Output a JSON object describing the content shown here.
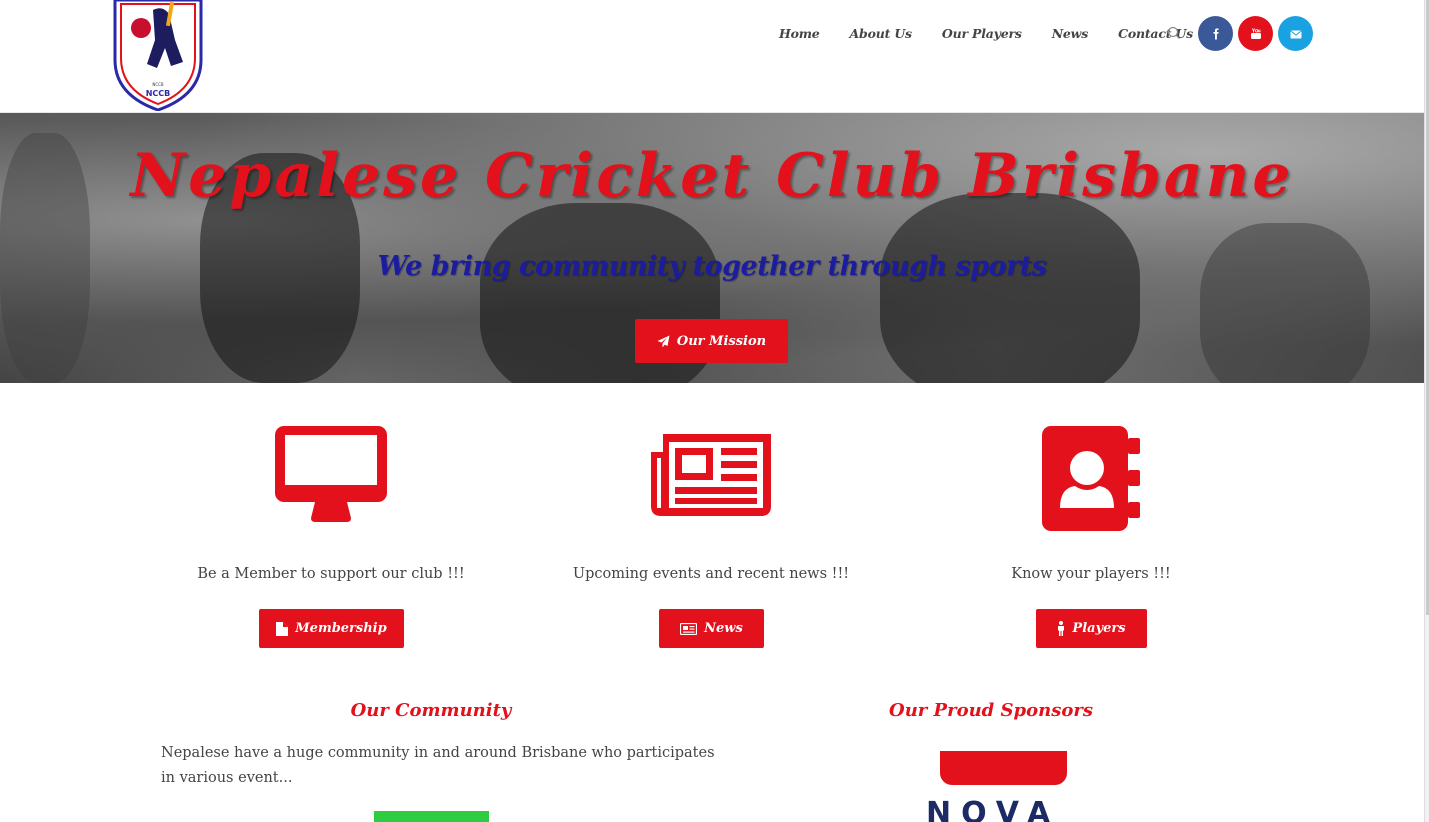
{
  "header": {
    "logo_alt": "NCCB",
    "logo_text": "NCCB",
    "nav": [
      "Home",
      "About Us",
      "Our Players",
      "News",
      "Contact Us"
    ],
    "search_icon": "search-icon",
    "social": [
      "facebook-icon",
      "youtube-icon",
      "email-icon"
    ]
  },
  "hero": {
    "title": "Nepalese Cricket Club Brisbane",
    "subtitle": "We bring community together through sports",
    "button_label": "Our Mission",
    "button_icon": "paper-plane-icon"
  },
  "features": [
    {
      "icon": "desktop-icon",
      "text": "Be a Member to support our club !!!",
      "button": "Membership",
      "button_icon": "file-icon"
    },
    {
      "icon": "newspaper-icon",
      "text": "Upcoming events and recent news !!!",
      "button": "News",
      "button_icon": "newspaper-icon"
    },
    {
      "icon": "address-book-icon",
      "text": "Know your players !!!",
      "button": "Players",
      "button_icon": "male-icon"
    }
  ],
  "community": {
    "title": "Our Community",
    "text": "Nepalese have a huge community in and around Brisbane who participates in various event..."
  },
  "sponsors": {
    "title": "Our Proud Sponsors",
    "sponsor_text": "NOVA"
  },
  "colors": {
    "accent": "#e3111b",
    "subtitle": "#1c1c9e",
    "facebook": "#3b5998",
    "youtube": "#e3111b",
    "email": "#1aa1e1"
  }
}
